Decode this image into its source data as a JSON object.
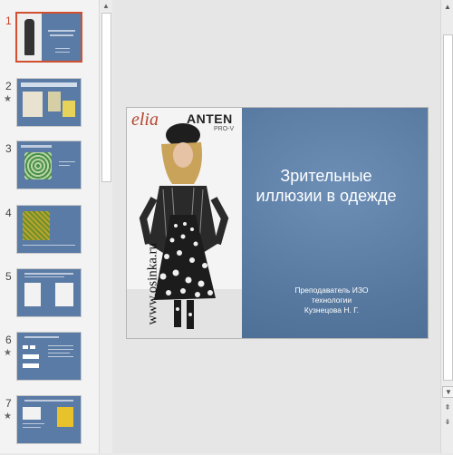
{
  "thumbnails": [
    {
      "number": "1",
      "active": true,
      "star": "",
      "kind": "title"
    },
    {
      "number": "2",
      "active": false,
      "star": "★",
      "kind": "image"
    },
    {
      "number": "3",
      "active": false,
      "star": "",
      "kind": "pattern"
    },
    {
      "number": "4",
      "active": false,
      "star": "",
      "kind": "grid"
    },
    {
      "number": "5",
      "active": false,
      "star": "",
      "kind": "diagram"
    },
    {
      "number": "6",
      "active": false,
      "star": "★",
      "kind": "list"
    },
    {
      "number": "7",
      "active": false,
      "star": "★",
      "kind": "image"
    }
  ],
  "slide": {
    "title_line1": "Зрительные",
    "title_line2": "иллюзии в одежде",
    "subtitle_line1": "Преподаватель ИЗО",
    "subtitle_line2": "технологии",
    "subtitle_line3": "Кузнецова Н. Г.",
    "watermark": "www.osinka.ru",
    "brand_left": "elia",
    "brand_right": "ANTEN",
    "brand_small": "PRO-V"
  },
  "icons": {
    "scroll_up": "▲",
    "scroll_down": "▼",
    "prev_slide": "⇞",
    "next_slide": "⇟"
  },
  "colors": {
    "active_accent": "#d2502f",
    "slide_background": "#4f7199"
  }
}
